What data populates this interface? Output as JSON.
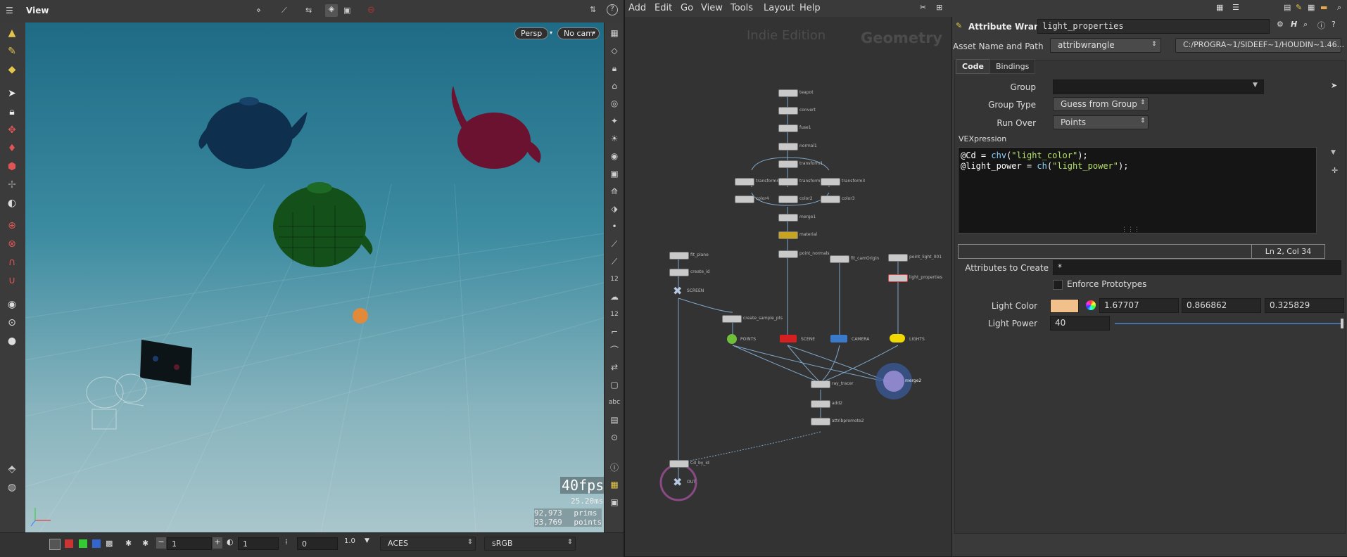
{
  "viewer": {
    "title": "View",
    "camera_persp": "Persp",
    "camera_nocam": "No cam",
    "fps": "40fps",
    "ms": "25.20ms",
    "prims_count": "92,973",
    "prims_label": "prims",
    "points_count": "93,769",
    "points_label": "points",
    "bottom": {
      "field1": "1",
      "field2": "1",
      "field3": "0",
      "colorspace": "ACES",
      "display": "sRGB"
    }
  },
  "network": {
    "menu": [
      "Add",
      "Edit",
      "Go",
      "View",
      "Tools",
      "Layout",
      "Help"
    ],
    "watermark_edition": "Indie Edition",
    "watermark_context": "Geometry",
    "nodes": [
      {
        "name": "teapot",
        "label": "teapot"
      },
      {
        "name": "convert",
        "label": "convert"
      },
      {
        "name": "fuse1",
        "label": "fuse1"
      },
      {
        "name": "normal1",
        "label": "normal1"
      },
      {
        "name": "transform1",
        "label": "transform1"
      },
      {
        "name": "transform4",
        "label": "transform4"
      },
      {
        "name": "transform2",
        "label": "transform2"
      },
      {
        "name": "transform3",
        "label": "transform3"
      },
      {
        "name": "color4",
        "label": "color4"
      },
      {
        "name": "color2",
        "label": "color2"
      },
      {
        "name": "color3",
        "label": "color3"
      },
      {
        "name": "merge1",
        "label": "merge1"
      },
      {
        "name": "material",
        "label": "material"
      },
      {
        "name": "point_normals",
        "label": "point_normals"
      },
      {
        "name": "fit_plane",
        "label": "fit_plane"
      },
      {
        "name": "create_id",
        "label": "create_id"
      },
      {
        "name": "screen",
        "label": "SCREEN"
      },
      {
        "name": "create_sample_pts",
        "label": "create_sample_pts"
      },
      {
        "name": "points",
        "label": "POINTS"
      },
      {
        "name": "scene",
        "label": "SCENE"
      },
      {
        "name": "fit_camorigin",
        "label": "fit_camOrigin"
      },
      {
        "name": "camera",
        "label": "CAMERA"
      },
      {
        "name": "point_light_001",
        "label": "point_light_001"
      },
      {
        "name": "light_properties",
        "label": "light_properties"
      },
      {
        "name": "lights",
        "label": "LIGHTS"
      },
      {
        "name": "merge2",
        "label": "merge2"
      },
      {
        "name": "ray_tracer",
        "label": "ray_tracer"
      },
      {
        "name": "add2",
        "label": "add2"
      },
      {
        "name": "attribpromote2",
        "label": "attribpromote2"
      },
      {
        "name": "cd_by_id",
        "label": "Cd_by_id"
      },
      {
        "name": "out",
        "label": "OUT"
      }
    ]
  },
  "params": {
    "node_type": "Attribute Wrangle",
    "node_name": "light_properties",
    "asset_label": "Asset Name and Path",
    "asset_value": "attribwrangle",
    "asset_path": "C:/PROGRA~1/SIDEEF~1/HOUDIN~1.46...",
    "tabs": [
      "Code",
      "Bindings"
    ],
    "group_label": "Group",
    "group_value": "",
    "group_type_label": "Group Type",
    "group_type_value": "Guess from Group",
    "run_over_label": "Run Over",
    "run_over_value": "Points",
    "vex_label": "VEXpression",
    "code_line1": {
      "var": "@Cd",
      "op": " = ",
      "fn": "chv",
      "open": "(",
      "str": "\"light_color\"",
      "close": ");"
    },
    "code_line2": {
      "var": "@light_power",
      "op": " = ",
      "fn": "ch",
      "open": "(",
      "str": "\"light_power\"",
      "close": ");"
    },
    "cursor_pos": "Ln 2, Col 34",
    "attrs_label": "Attributes to Create",
    "attrs_value": "*",
    "enforce_label": "Enforce Prototypes",
    "light_color_label": "Light Color",
    "light_color_swatch": "#f2c08a",
    "light_color_r": "1.67707",
    "light_color_g": "0.866862",
    "light_color_b": "0.325829",
    "light_power_label": "Light Power",
    "light_power_value": "40"
  }
}
